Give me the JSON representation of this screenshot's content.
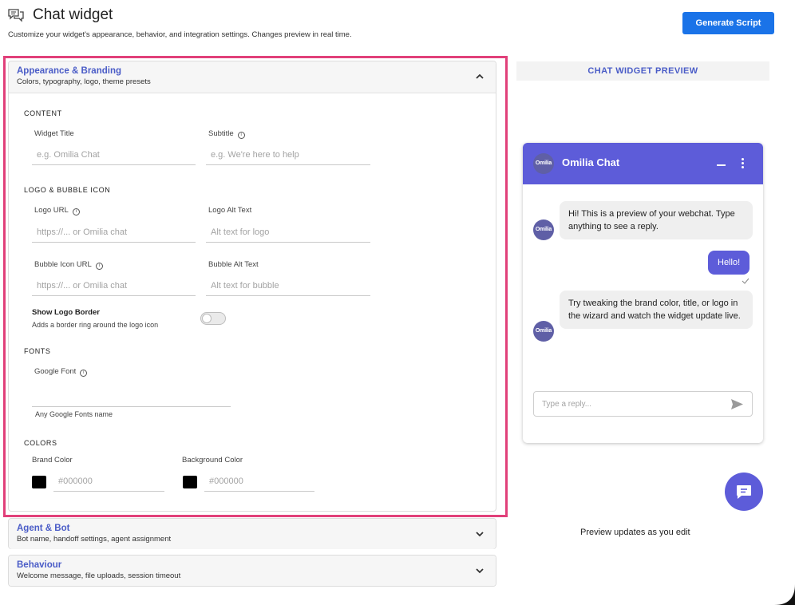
{
  "header": {
    "icon": "chat-bubbles-icon",
    "title": "Chat widget",
    "subtitle": "Customize your widget's appearance, behavior, and integration settings. Changes preview in real time.",
    "generate_label": "Generate Script",
    "accent_color": "#1a73e8"
  },
  "appearance": {
    "title": "Appearance & Branding",
    "description": "Colors, typography, logo, theme presets",
    "content": {
      "section_label": "CONTENT",
      "widget_title_label": "Widget Title",
      "widget_title_placeholder": "e.g. Omilia Chat",
      "subtitle_label": "Subtitle",
      "subtitle_placeholder": "e.g. We're here to help"
    },
    "logo": {
      "section_label": "LOGO & BUBBLE ICON",
      "logo_url_label": "Logo URL",
      "logo_url_placeholder": "https://... or Omilia chat",
      "logo_alt_label": "Logo Alt Text",
      "logo_alt_placeholder": "Alt text for logo",
      "bubble_url_label": "Bubble Icon URL",
      "bubble_url_placeholder": "https://... or Omilia chat",
      "bubble_alt_label": "Bubble Alt Text",
      "bubble_alt_placeholder": "Alt text for bubble",
      "show_border_label": "Show Logo Border",
      "show_border_help": "Adds a border ring around the logo icon"
    },
    "fonts": {
      "section_label": "FONTS",
      "google_font_label": "Google Font",
      "google_font_help": "Any Google Fonts name"
    },
    "colors": {
      "section_label": "COLORS",
      "brand_label": "Brand Color",
      "brand_placeholder": "#000000",
      "background_label": "Background Color",
      "background_placeholder": "#000000"
    }
  },
  "agent": {
    "title": "Agent & Bot",
    "description": "Bot name, handoff settings, agent assignment"
  },
  "behaviour": {
    "title": "Behaviour",
    "description": "Welcome message, file uploads, session timeout"
  },
  "preview": {
    "header": "CHAT WIDGET PREVIEW",
    "widget_title": "Omilia Chat",
    "avatar_text": "Omilia",
    "brand_color": "#5d5cd9",
    "messages": {
      "bot1": "Hi! This is a preview of your webchat. Type anything to see a reply.",
      "user1": "Hello!",
      "bot2": "Try tweaking the brand color, title, or logo in the wizard and watch the widget update live."
    },
    "input_placeholder": "Type a reply...",
    "footer": "Preview updates as you edit"
  }
}
